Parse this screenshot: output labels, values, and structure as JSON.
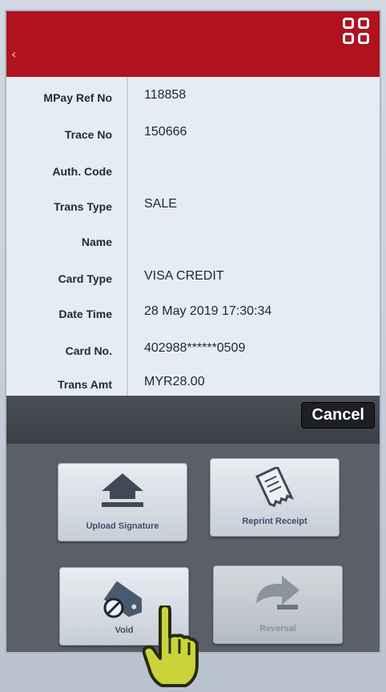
{
  "header": {
    "back_icon": "chevron-left-icon",
    "menu_icon": "grid-menu-icon",
    "accent": "#b0121e"
  },
  "details": [
    {
      "label": "MPay Ref No",
      "value": "118858"
    },
    {
      "label": "Trace No",
      "value": "150666"
    },
    {
      "label": "Auth. Code",
      "value": ""
    },
    {
      "label": "Trans Type",
      "value": "SALE"
    },
    {
      "label": "Name",
      "value": ""
    },
    {
      "label": "Card Type",
      "value": "VISA CREDIT"
    },
    {
      "label": "Date Time",
      "value": "28 May 2019 17:30:34"
    },
    {
      "label": "Card No.",
      "value": "402988******0509"
    },
    {
      "label": "Trans Amt",
      "value": "MYR28.00"
    }
  ],
  "actions": {
    "cancel_label": "Cancel",
    "upload_signature": {
      "label": "Upload Signature",
      "icon": "upload-icon"
    },
    "reprint_receipt": {
      "label": "Reprint Receipt",
      "icon": "receipt-icon"
    },
    "void": {
      "label": "Void",
      "icon": "void-tag-icon"
    },
    "reversal": {
      "label": "Reversal",
      "icon": "reversal-icon",
      "disabled": true
    }
  }
}
